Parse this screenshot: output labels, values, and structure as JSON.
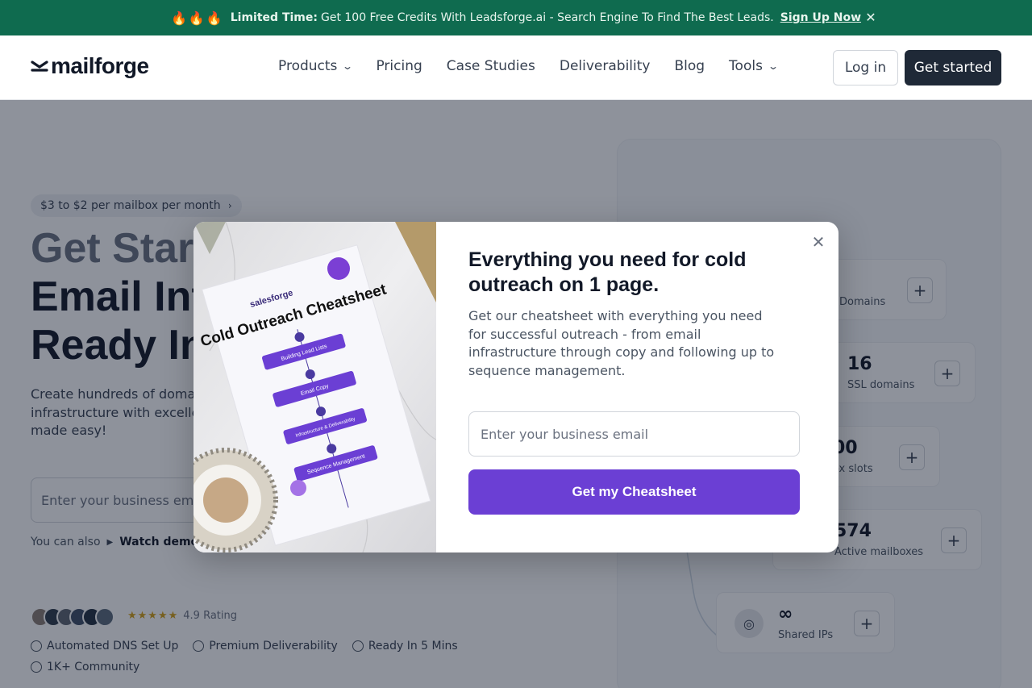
{
  "banner": {
    "emoji": "🔥🔥🔥",
    "strong": "Limited Time:",
    "text": "Get 100 Free Credits With Leadsforge.ai - Search Engine To Find The Best Leads.",
    "link": "Sign Up Now",
    "close_icon": "close-icon"
  },
  "header": {
    "logo": "mailforge",
    "nav": [
      {
        "label": "Products",
        "has_dropdown": true
      },
      {
        "label": "Pricing",
        "has_dropdown": false
      },
      {
        "label": "Case Studies",
        "has_dropdown": false
      },
      {
        "label": "Deliverability",
        "has_dropdown": false
      },
      {
        "label": "Blog",
        "has_dropdown": false
      },
      {
        "label": "Tools",
        "has_dropdown": true
      }
    ],
    "login": "Log in",
    "get_started": "Get started"
  },
  "hero": {
    "pill": "$3 to $2 per mailbox per month",
    "title_line1": "Get Start",
    "title_line2": "Email Inf",
    "title_line3": "Ready In",
    "subtitle": "Create hundreds of domain infrastructure with excellen outreach made easy!",
    "input_placeholder": "Enter your business email",
    "also_text": "You can also",
    "demo_link": "Watch demo v",
    "rating": "4.9 Rating",
    "stars": "★★★★★",
    "features": [
      "Automated DNS Set Up",
      "Premium Deliverability",
      "Ready In 5 Mins",
      "1K+ Community"
    ]
  },
  "stats": [
    {
      "num": "",
      "label": "Domains"
    },
    {
      "num": "16",
      "label": "SSL domains"
    },
    {
      "num": "00",
      "label": "ox slots"
    },
    {
      "num": "574",
      "label": "Active mailboxes"
    },
    {
      "num": "∞",
      "label": "Shared IPs"
    }
  ],
  "modal": {
    "title": "Everything you need for cold outreach on 1 page.",
    "description": "Get our cheatsheet with everything you need for successful outreach - from email infrastructure through copy and following up to sequence management.",
    "input_placeholder": "Enter your business email",
    "button": "Get my Cheatsheet",
    "image": {
      "brand": "salesforge",
      "heading": "Cold Outreach Cheatsheet",
      "steps": [
        "Building Lead Lists",
        "Email Copy",
        "Infrastructure & Deliverability",
        "Sequence Management"
      ]
    }
  },
  "colors": {
    "banner": "#0f6b4f",
    "primary_button": "#6b3fd4",
    "dark_button": "#1f2937",
    "stars": "#d4a017"
  }
}
